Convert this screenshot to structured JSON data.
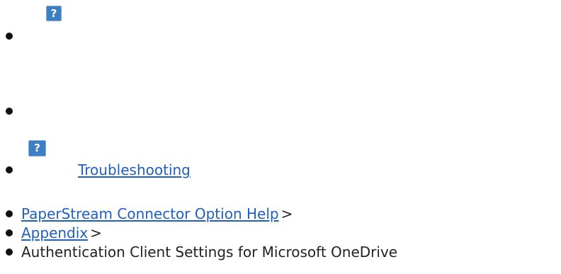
{
  "icons": {
    "help_top": "help-icon",
    "help_troubleshooting": "help-icon",
    "help_glyph": "?"
  },
  "nav": {
    "troubleshooting": "Troubleshooting",
    "breadcrumb": {
      "help": "PaperStream Connector Option Help",
      "appendix": "Appendix",
      "separator": ">",
      "current": "Authentication Client Settings for Microsoft OneDrive"
    }
  }
}
